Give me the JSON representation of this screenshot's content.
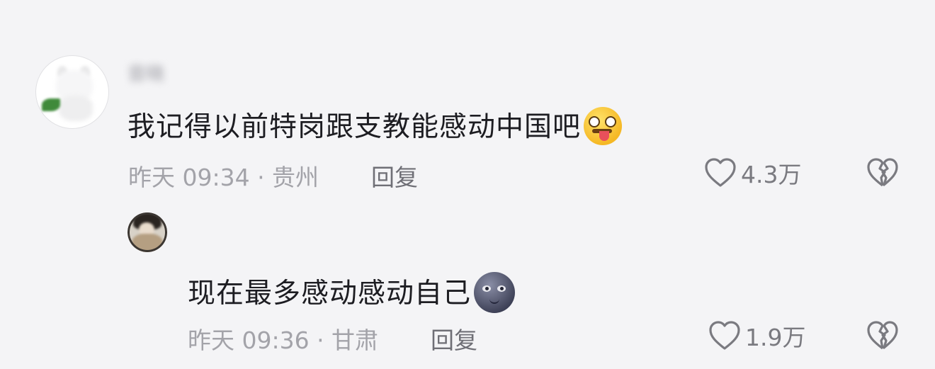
{
  "comments": [
    {
      "author": "音晓",
      "text": "我记得以前特岗跟支教能感动中国吧",
      "emoji": "crazy-face-emoji",
      "time_location": "昨天 09:34 · 贵州",
      "reply_label": "回复",
      "likes": "4.3万"
    },
    {
      "author": "",
      "text": "现在最多感动感动自己",
      "emoji": "new-moon-face-emoji",
      "time_location": "昨天 09:36 · 甘肃",
      "reply_label": "回复",
      "likes": "1.9万"
    }
  ],
  "icons": {
    "like": "heart-outline-icon",
    "dislike": "broken-heart-icon"
  },
  "colors": {
    "background": "#f4f4f6",
    "text": "#1d1d22",
    "meta": "#a3a3a9",
    "icon": "#7a7a80"
  }
}
